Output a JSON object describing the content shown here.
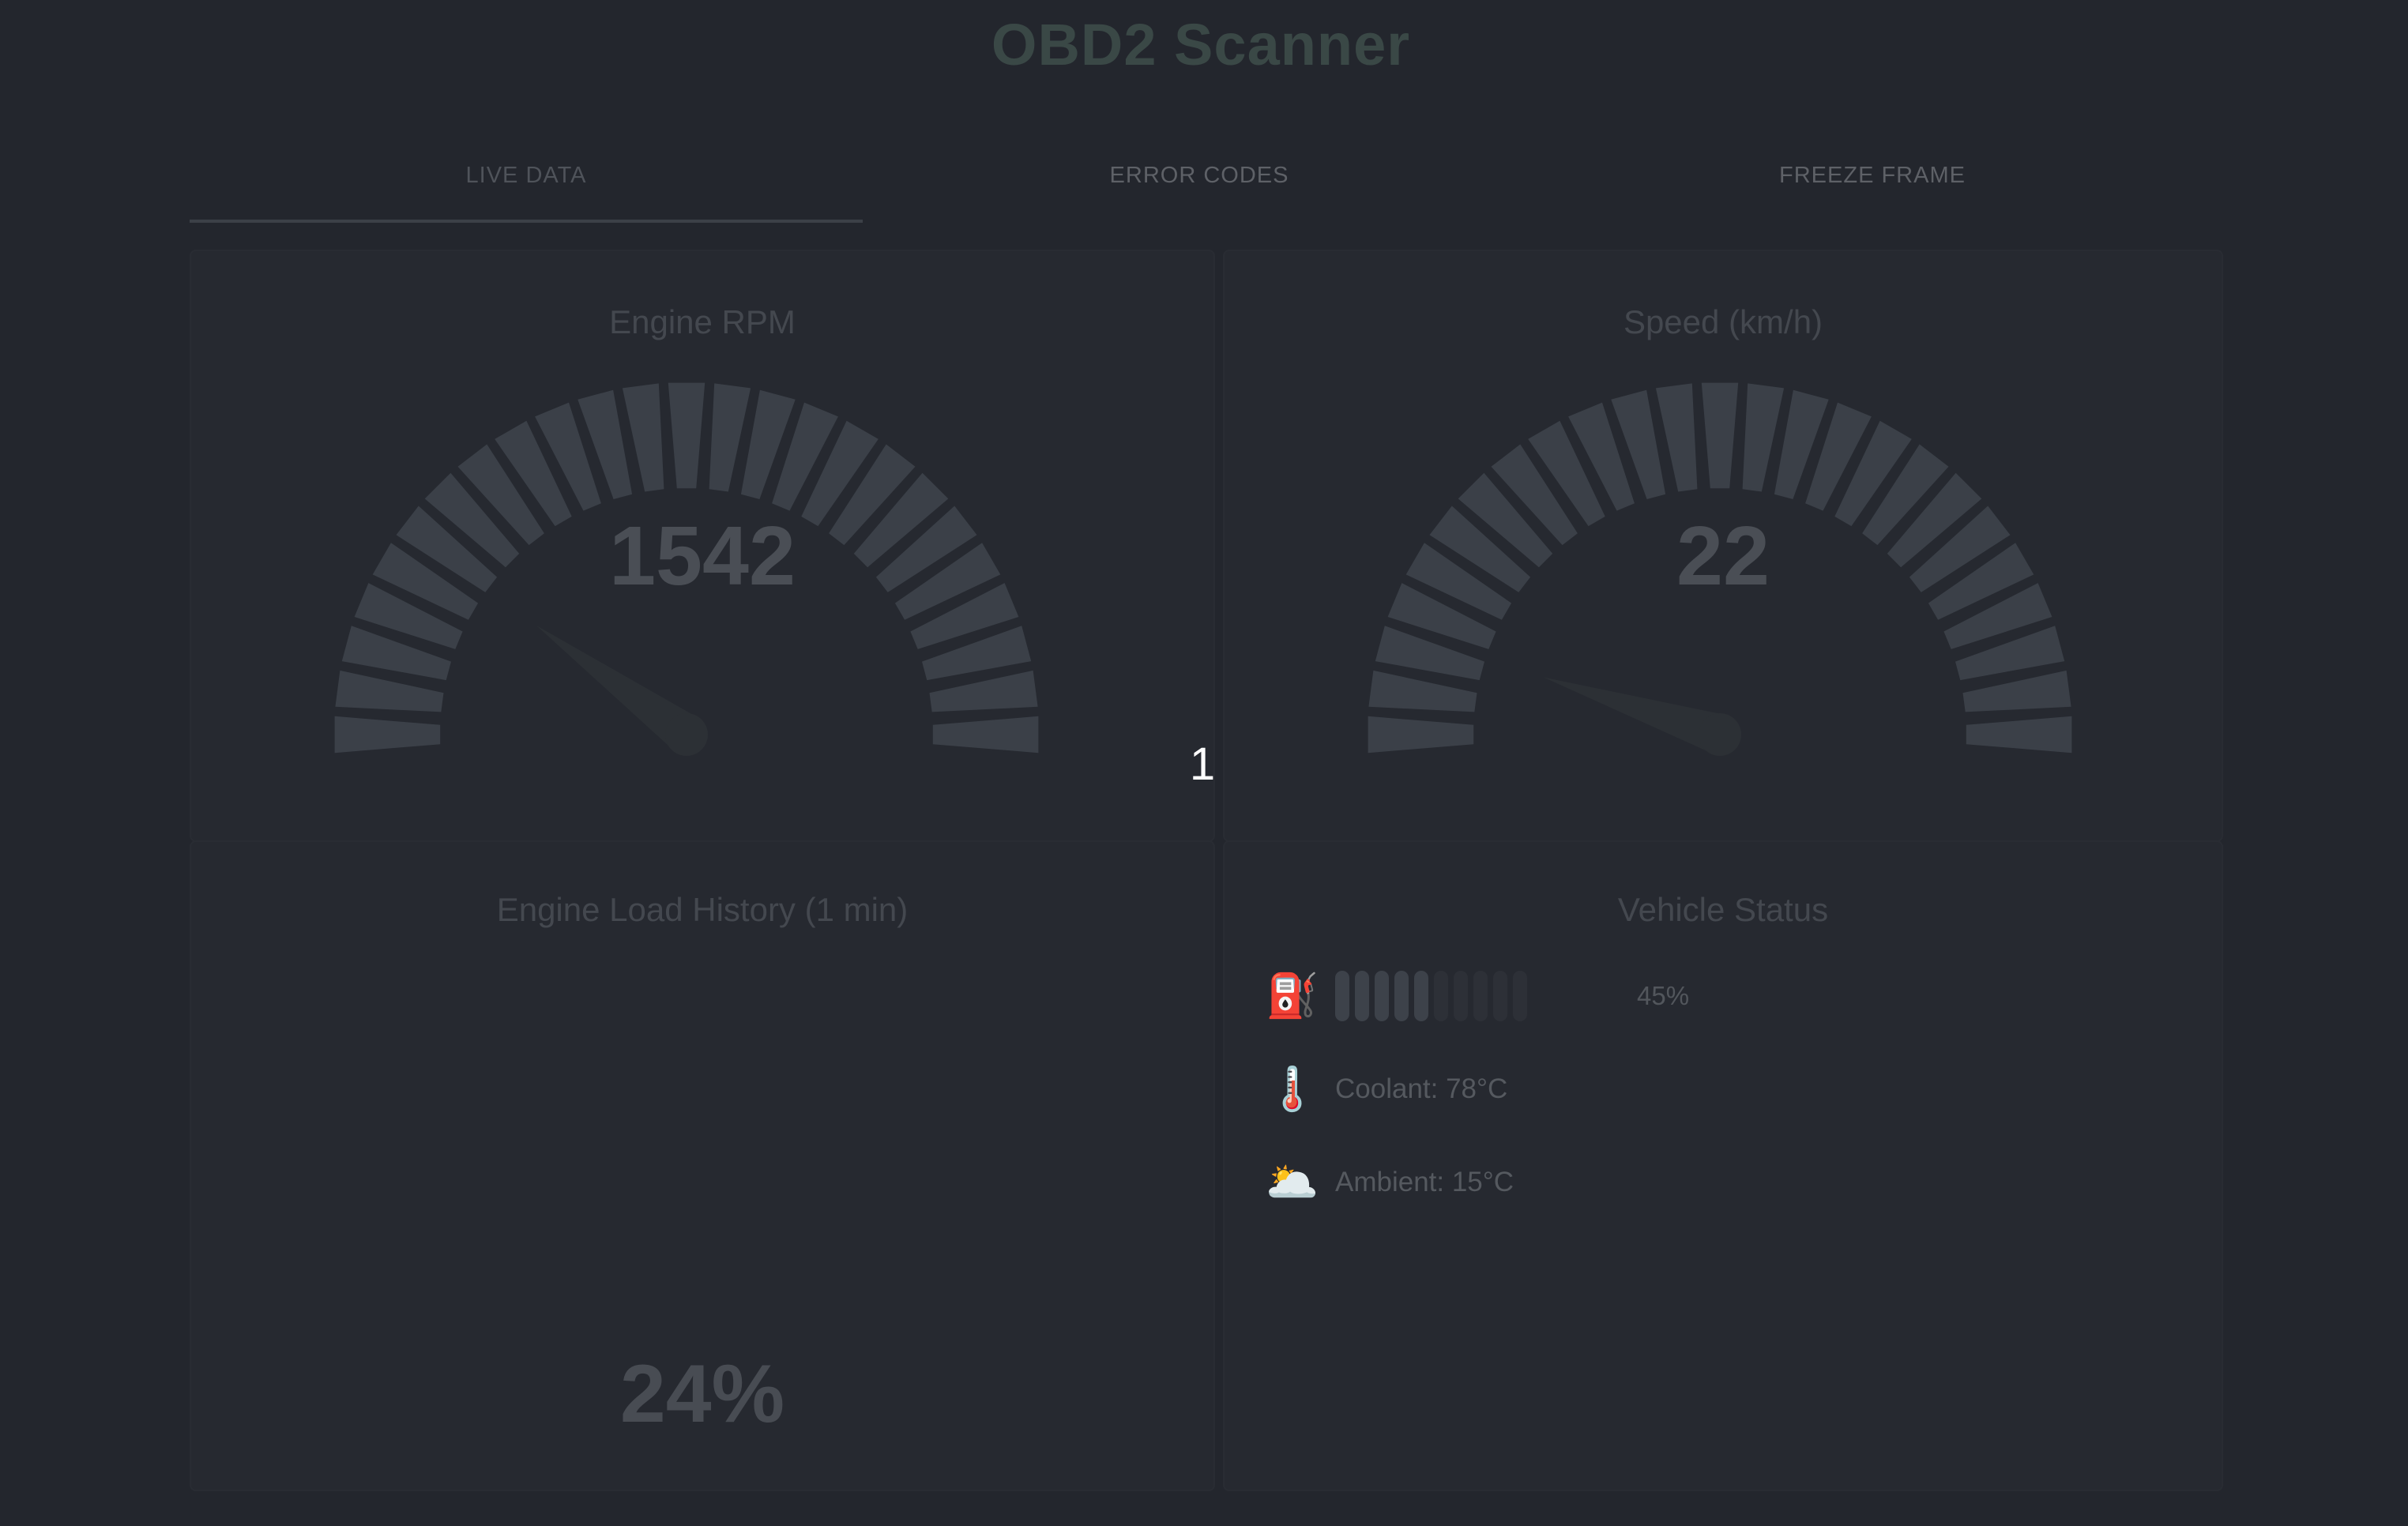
{
  "app": {
    "title": "OBD2 Scanner"
  },
  "tabs": [
    {
      "label": "LIVE DATA",
      "active": true
    },
    {
      "label": "ERROR CODES",
      "active": false
    },
    {
      "label": "FREEZE FRAME",
      "active": false
    }
  ],
  "gauges": {
    "rpm": {
      "title": "Engine RPM",
      "value": "1542",
      "needle_fraction": 0.2
    },
    "speed": {
      "title": "Speed (km/h)",
      "value": "22",
      "needle_fraction": 0.1
    }
  },
  "page_marker": "1",
  "load_history": {
    "title": "Engine Load History (1 min)",
    "value": "24%"
  },
  "vehicle_status": {
    "title": "Vehicle Status",
    "fuel": {
      "icon": "fuel-pump-icon",
      "percent": "45%",
      "level": 0.45,
      "segments": 10
    },
    "coolant": {
      "icon": "thermometer-icon",
      "text": "Coolant: 78°C"
    },
    "ambient": {
      "icon": "sun-behind-cloud-icon",
      "text": "Ambient: 15°C"
    }
  },
  "colors": {
    "background": "#23262d",
    "gauge_tick": "#3b4048",
    "needle": "#2c3035",
    "fuel_active": "#3d424a",
    "fuel_inactive": "#2d3037"
  }
}
